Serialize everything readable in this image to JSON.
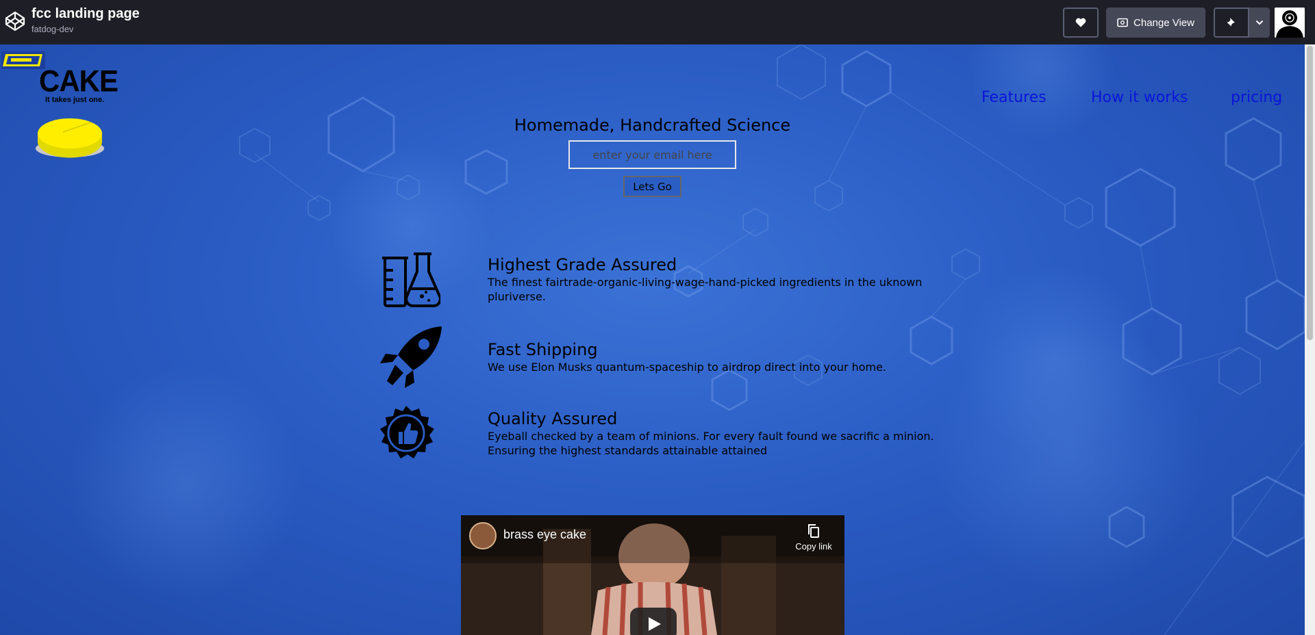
{
  "topbar": {
    "title": "fcc landing page",
    "author": "fatdog-dev",
    "change_view_label": "Change View"
  },
  "logo": {
    "text": "CAKE",
    "tagline": "It takes just one."
  },
  "nav": {
    "items": [
      "Features",
      "How it works",
      "pricing"
    ]
  },
  "hero": {
    "headline": "Homemade, Handcrafted Science",
    "email_placeholder": "enter your email here",
    "submit_label": "Lets Go"
  },
  "features": [
    {
      "icon": "flask-beaker-icon",
      "title": "Highest Grade Assured",
      "text": "The finest fairtrade-organic-living-wage-hand-picked ingredients in the uknown pluriverse."
    },
    {
      "icon": "rocket-icon",
      "title": "Fast Shipping",
      "text": "We use Elon Musks quantum-spaceship to airdrop direct into your home."
    },
    {
      "icon": "thumbs-up-badge-icon",
      "title": "Quality Assured",
      "text": "Eyeball checked by a team of minions. For every fault found we sacrific a minion. Ensuring the highest standards attainable attained"
    }
  ],
  "video": {
    "title": "brass eye cake",
    "copy_label": "Copy link"
  },
  "colors": {
    "topbar": "#1e1f26",
    "background": "#2a5cc4",
    "nav_link": "#0a14d8"
  }
}
